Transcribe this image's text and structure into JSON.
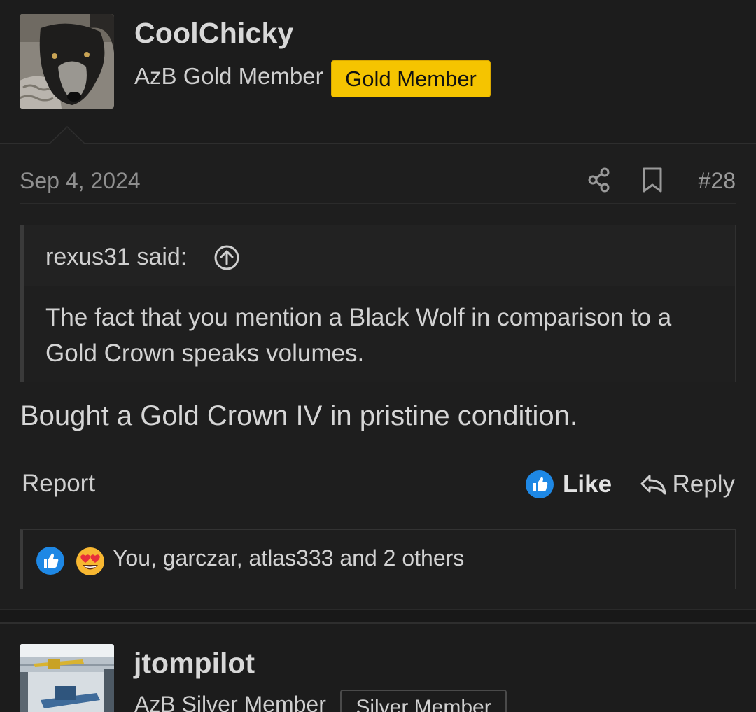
{
  "post1": {
    "username": "CoolChicky",
    "user_title": "AzB Gold Member",
    "banner": "Gold Member",
    "date": "Sep 4, 2024",
    "post_number": "#28",
    "quote": {
      "author": "rexus31 said:",
      "text": "The fact that you mention a Black Wolf in comparison to a Gold Crown speaks volumes."
    },
    "message": "Bought a Gold Crown IV in pristine condition.",
    "actions": {
      "report": "Report",
      "like": "Like",
      "reply": "Reply"
    },
    "reactions_text": "You, garczar, atlas333 and 2 others"
  },
  "post2": {
    "username": "jtompilot",
    "user_title": "AzB Silver Member",
    "banner": "Silver Member"
  },
  "colors": {
    "background": "#1c1c1c",
    "gold_banner": "#f5c400",
    "like_blue": "#1e88e5"
  },
  "icons": [
    "share-icon",
    "bookmark-icon",
    "arrow-up-circle-icon",
    "like-icon",
    "reply-icon",
    "heart-eyes-icon"
  ]
}
